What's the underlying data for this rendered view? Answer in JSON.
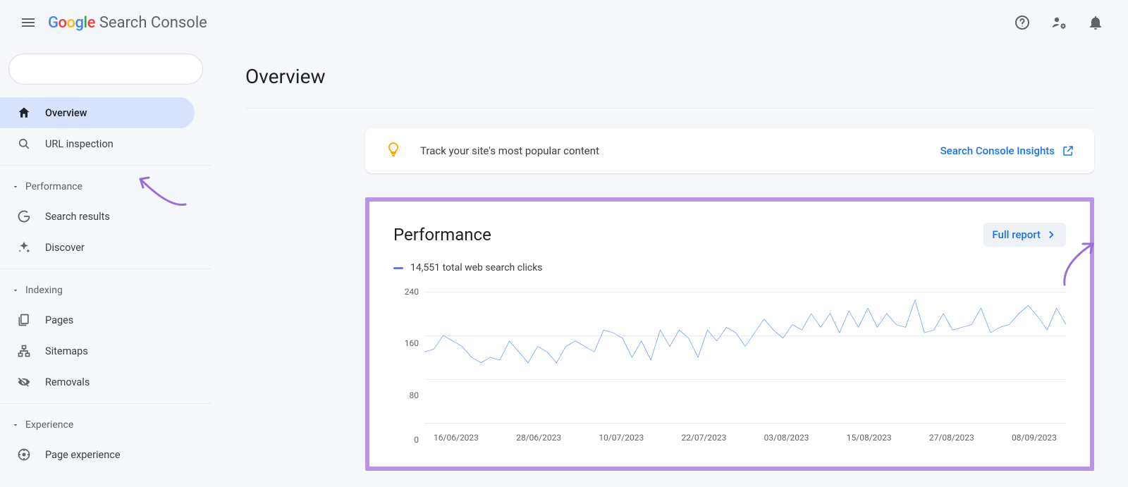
{
  "header": {
    "product_sc": "Search Console"
  },
  "sidebar": {
    "items": {
      "overview": "Overview",
      "url_inspection": "URL inspection",
      "search_results": "Search results",
      "discover": "Discover",
      "pages": "Pages",
      "sitemaps": "Sitemaps",
      "removals": "Removals",
      "page_experience": "Page experience"
    },
    "sections": {
      "performance": "Performance",
      "indexing": "Indexing",
      "experience": "Experience"
    }
  },
  "main": {
    "page_title": "Overview",
    "insights": {
      "text": "Track your site's most popular content",
      "link": "Search Console Insights"
    },
    "performance": {
      "title": "Performance",
      "full_report": "Full report",
      "legend": "14,551 total web search clicks"
    }
  },
  "chart_data": {
    "type": "line",
    "title": "Performance",
    "xlabel": "",
    "ylabel": "",
    "ylim": [
      0,
      240
    ],
    "yticks": [
      0,
      80,
      160,
      240
    ],
    "x_categories": [
      "16/06/2023",
      "28/06/2023",
      "10/07/2023",
      "22/07/2023",
      "03/08/2023",
      "15/08/2023",
      "27/08/2023",
      "08/09/2023"
    ],
    "series": [
      {
        "name": "total web search clicks",
        "color": "#4285f4",
        "values": [
          130,
          135,
          160,
          150,
          140,
          120,
          110,
          120,
          115,
          150,
          130,
          110,
          140,
          130,
          110,
          140,
          150,
          140,
          130,
          170,
          165,
          155,
          120,
          150,
          115,
          170,
          140,
          170,
          155,
          120,
          170,
          150,
          175,
          165,
          140,
          165,
          190,
          170,
          155,
          180,
          170,
          200,
          175,
          200,
          165,
          205,
          175,
          210,
          175,
          200,
          180,
          175,
          225,
          165,
          170,
          200,
          170,
          175,
          180,
          210,
          165,
          175,
          180,
          200,
          215,
          195,
          170,
          210,
          180
        ]
      }
    ]
  }
}
